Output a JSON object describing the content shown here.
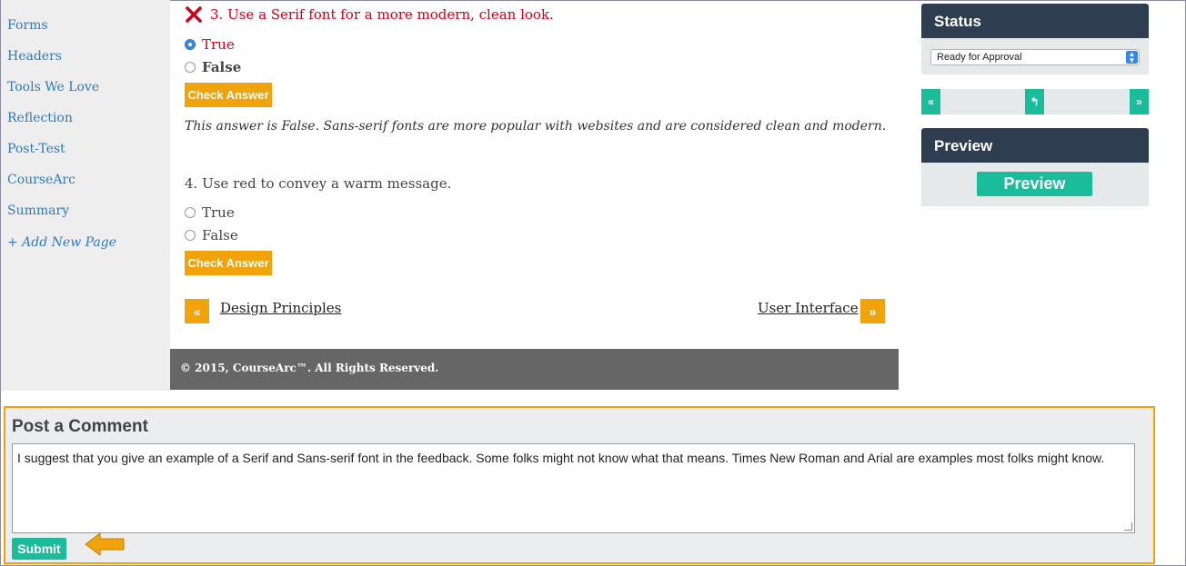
{
  "sidebar": {
    "items": [
      {
        "label": "Forms"
      },
      {
        "label": "Headers"
      },
      {
        "label": "Tools We Love"
      },
      {
        "label": "Reflection"
      },
      {
        "label": "Post-Test"
      },
      {
        "label": "CourseArc"
      },
      {
        "label": "Summary"
      }
    ],
    "add_page": "+ Add New Page"
  },
  "question3": {
    "text": "3. Use a Serif font for a more modern, clean look.",
    "status_icon": "x-icon",
    "options": [
      {
        "label": "True",
        "selected": true
      },
      {
        "label": "False",
        "selected": false
      }
    ],
    "check_label": "Check Answer",
    "feedback": "This answer is False. Sans-serif fonts are more popular with websites and are considered clean and modern."
  },
  "question4": {
    "text": "4. Use red to convey a warm message.",
    "options": [
      {
        "label": "True",
        "selected": false
      },
      {
        "label": "False",
        "selected": false
      }
    ],
    "check_label": "Check Answer"
  },
  "pager": {
    "prev_symbol": "«",
    "prev_label": "Design Principles",
    "next_label": "User Interface",
    "next_symbol": "»"
  },
  "footer": {
    "text": "© 2015, CourseArc™. All Rights Reserved."
  },
  "status_panel": {
    "title": "Status",
    "selected": "Ready for Approval"
  },
  "nav_strip": {
    "first": "«",
    "back": "↰",
    "last": "»"
  },
  "preview_panel": {
    "title": "Preview",
    "button": "Preview"
  },
  "comment": {
    "title": "Post a Comment",
    "value": "I suggest that you give an example of a Serif and Sans-serif font in the feedback. Some folks might not know what that means.  Times New Roman and Arial are examples most folks might know.",
    "submit": "Submit"
  },
  "colors": {
    "accent_orange": "#f0a30a",
    "teal": "#1abc9c",
    "panel_dark": "#2e3e50",
    "error_red": "#d0021b",
    "link_blue": "#2f7bbf"
  }
}
